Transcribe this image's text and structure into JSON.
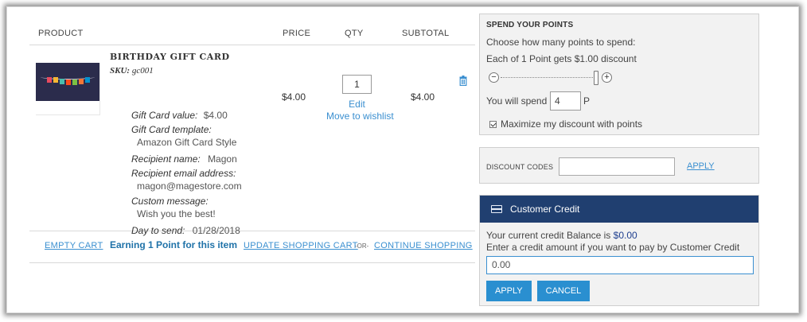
{
  "cart": {
    "headers": {
      "product": "PRODUCT",
      "price": "PRICE",
      "qty": "QTY",
      "subtotal": "SUBTOTAL"
    },
    "item": {
      "name": "BIRTHDAY GIFT CARD",
      "sku_label": "SKU:",
      "sku": "gc001",
      "price": "$4.00",
      "qty": "1",
      "edit": "Edit",
      "wishlist": "Move to wishlist",
      "subtotal": "$4.00",
      "options": {
        "value_label": "Gift Card value:",
        "value": "$4.00",
        "template_label": "Gift Card template:",
        "template": "Amazon Gift Card Style",
        "recipient_label": "Recipient name:",
        "recipient": "Magon",
        "email_label": "Recipient email address:",
        "email": "magon@magestore.com",
        "message_label": "Custom message:",
        "message": "Wish you the best!",
        "day_label": "Day to send:",
        "day": "01/28/2018"
      },
      "earning": "Earning 1 Point for this item"
    },
    "actions": {
      "empty": "EMPTY CART",
      "update": "UPDATE SHOPPING CART",
      "or": "-OR-",
      "continue": "CONTINUE SHOPPING"
    }
  },
  "points": {
    "title": "SPEND YOUR POINTS",
    "choose": "Choose how many points to spend:",
    "rate": "Each of 1 Point gets $1.00 discount",
    "spend_label": "You will spend",
    "spend_value": "4",
    "spend_unit": "P",
    "maximize": "Maximize my discount with points",
    "slider_level": 1.0
  },
  "discount": {
    "label": "DISCOUNT CODES",
    "apply": "APPLY"
  },
  "credit": {
    "title": "Customer Credit",
    "balance_text": "Your current credit Balance is",
    "balance": "$0.00",
    "enter_text": "Enter a credit amount if you want to pay by Customer Credit",
    "amount": "0.00",
    "apply": "APPLY",
    "cancel": "CANCEL"
  },
  "colors": {
    "link": "#3a8fd0",
    "header_bg": "#203f70",
    "button": "#2a8fd0"
  }
}
